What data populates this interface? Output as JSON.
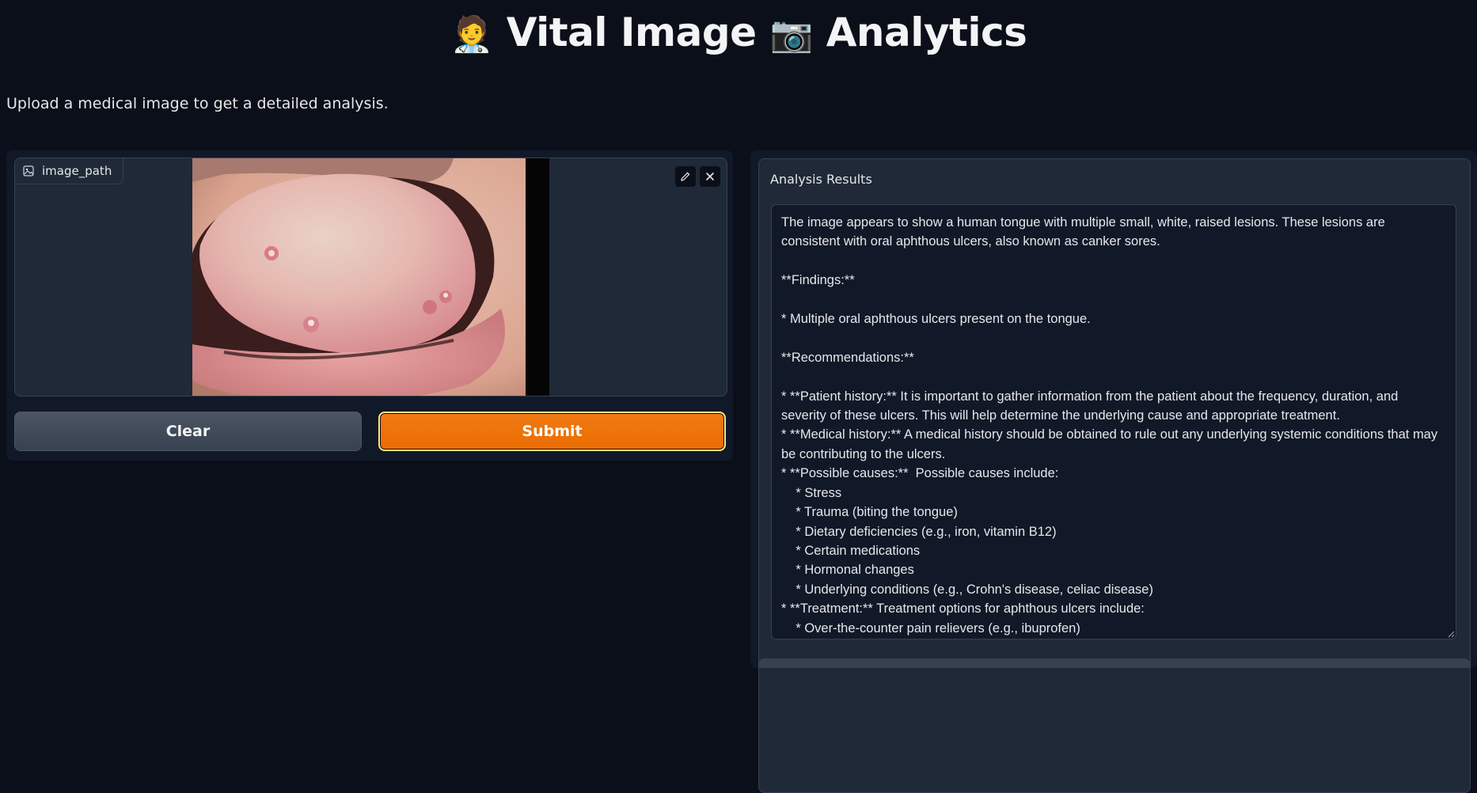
{
  "header": {
    "emoji_left": "🧑‍⚕️",
    "title_part1": "Vital Image",
    "emoji_mid": "📷",
    "title_part2": "Analytics"
  },
  "description": "Upload a medical image to get a detailed analysis.",
  "image_input": {
    "label": "image_path",
    "label_icon": "image-icon",
    "edit_icon": "pencil-icon",
    "close_icon": "close-icon",
    "content": "photo of a human tongue with small white raised lesions"
  },
  "buttons": {
    "clear": "Clear",
    "submit": "Submit"
  },
  "results": {
    "label": "Analysis Results",
    "text": "The image appears to show a human tongue with multiple small, white, raised lesions. These lesions are consistent with oral aphthous ulcers, also known as canker sores.\n\n**Findings:**\n\n* Multiple oral aphthous ulcers present on the tongue.\n\n**Recommendations:**\n\n* **Patient history:** It is important to gather information from the patient about the frequency, duration, and severity of these ulcers. This will help determine the underlying cause and appropriate treatment.\n* **Medical history:** A medical history should be obtained to rule out any underlying systemic conditions that may be contributing to the ulcers.\n* **Possible causes:**  Possible causes include:\n    * Stress\n    * Trauma (biting the tongue)\n    * Dietary deficiencies (e.g., iron, vitamin B12)\n    * Certain medications\n    * Hormonal changes\n    * Underlying conditions (e.g., Crohn's disease, celiac disease)\n* **Treatment:** Treatment options for aphthous ulcers include:\n    * Over-the-counter pain relievers (e.g., ibuprofen)"
  },
  "colors": {
    "background": "#0b0f19",
    "panel": "#111827",
    "block": "#1f2937",
    "accent": "#f07a14"
  }
}
